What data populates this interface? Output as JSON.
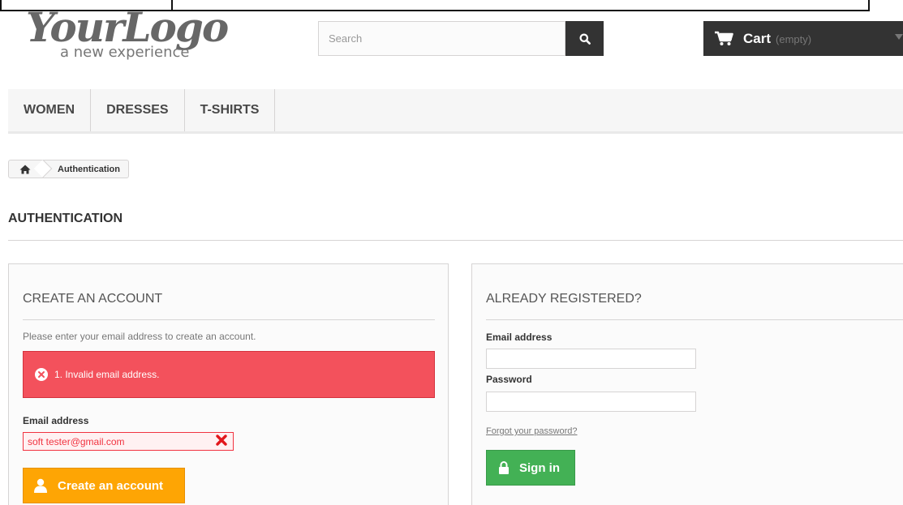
{
  "header": {
    "logo_main": "YourLogo",
    "logo_sub": "a new experience",
    "search": {
      "placeholder": "Search",
      "icon": "search-icon"
    },
    "cart": {
      "label": "Cart",
      "status": "(empty)",
      "icon": "cart-icon"
    }
  },
  "menu": {
    "items": [
      {
        "label": "WOMEN"
      },
      {
        "label": "DRESSES"
      },
      {
        "label": "T-SHIRTS"
      }
    ]
  },
  "breadcrumb": {
    "home_icon": "home-icon",
    "current": "Authentication"
  },
  "page_title": "AUTHENTICATION",
  "create_account": {
    "title": "CREATE AN ACCOUNT",
    "note": "Please enter your email address to create an account.",
    "error": "1. Invalid email address.",
    "email_label": "Email address",
    "email_value": "soft tester@gmail.com",
    "button_label": "Create an account"
  },
  "login": {
    "title": "ALREADY REGISTERED?",
    "email_label": "Email address",
    "email_value": "",
    "password_label": "Password",
    "password_value": "",
    "forgot_label": "Forgot your password?",
    "button_label": "Sign in"
  },
  "colors": {
    "dark": "#333333",
    "alert": "#f3515c",
    "create_button": "#fea504",
    "signin_button": "#43b155",
    "error_text": "#f13340"
  }
}
